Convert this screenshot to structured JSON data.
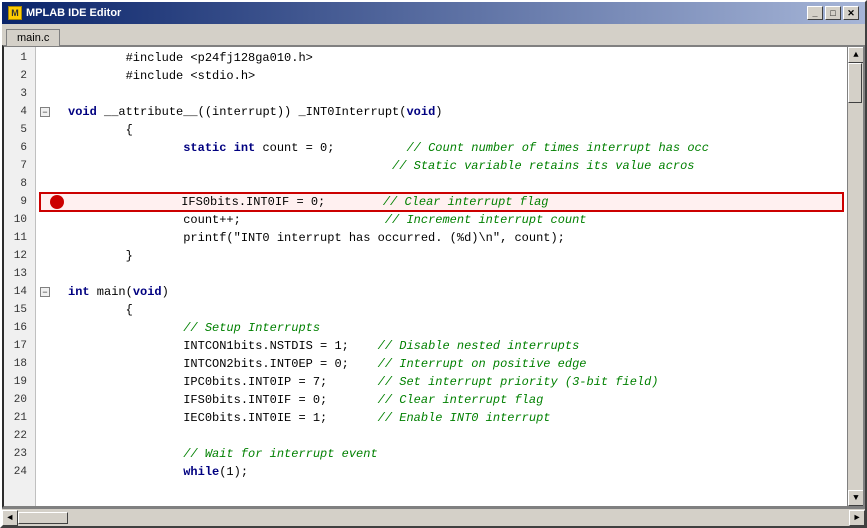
{
  "window": {
    "title": "MPLAB IDE Editor",
    "tab": "main.c"
  },
  "controls": {
    "minimize": "_",
    "maximize": "□",
    "close": "✕"
  },
  "lines": [
    {
      "num": 1,
      "indent": "",
      "fold": false,
      "breakpoint": false,
      "highlight": false,
      "tokens": [
        {
          "t": "normal",
          "v": "        #include <p24fj128ga010.h>"
        }
      ]
    },
    {
      "num": 2,
      "indent": "",
      "fold": false,
      "breakpoint": false,
      "highlight": false,
      "tokens": [
        {
          "t": "normal",
          "v": "        #include <stdio.h>"
        }
      ]
    },
    {
      "num": 3,
      "indent": "",
      "fold": false,
      "breakpoint": false,
      "highlight": false,
      "tokens": [
        {
          "t": "normal",
          "v": ""
        }
      ]
    },
    {
      "num": 4,
      "indent": "",
      "fold": true,
      "breakpoint": false,
      "highlight": false,
      "tokens": [
        {
          "t": "kw-blue",
          "v": "void"
        },
        {
          "t": "normal",
          "v": " __attribute__((interrupt)) _INT0Interrupt("
        },
        {
          "t": "kw-blue",
          "v": "void"
        },
        {
          "t": "normal",
          "v": ")"
        }
      ]
    },
    {
      "num": 5,
      "indent": "",
      "fold": false,
      "breakpoint": false,
      "highlight": false,
      "tokens": [
        {
          "t": "normal",
          "v": "        {"
        }
      ]
    },
    {
      "num": 6,
      "indent": "",
      "fold": false,
      "breakpoint": false,
      "highlight": false,
      "tokens": [
        {
          "t": "normal",
          "v": "                "
        },
        {
          "t": "kw-blue",
          "v": "static"
        },
        {
          "t": "normal",
          "v": " "
        },
        {
          "t": "kw-blue",
          "v": "int"
        },
        {
          "t": "normal",
          "v": " count = 0;          "
        },
        {
          "t": "comment",
          "v": "// Count number of times interrupt has occ"
        }
      ]
    },
    {
      "num": 7,
      "indent": "",
      "fold": false,
      "breakpoint": false,
      "highlight": false,
      "tokens": [
        {
          "t": "comment",
          "v": "                                             // Static variable retains its value acros"
        }
      ]
    },
    {
      "num": 8,
      "indent": "",
      "fold": false,
      "breakpoint": false,
      "highlight": false,
      "tokens": [
        {
          "t": "normal",
          "v": ""
        }
      ]
    },
    {
      "num": 9,
      "indent": "",
      "fold": false,
      "breakpoint": true,
      "highlight": true,
      "tokens": [
        {
          "t": "normal",
          "v": "                IFS0bits.INT0IF = 0;        "
        },
        {
          "t": "comment",
          "v": "// Clear interrupt flag"
        }
      ]
    },
    {
      "num": 10,
      "indent": "",
      "fold": false,
      "breakpoint": false,
      "highlight": false,
      "tokens": [
        {
          "t": "normal",
          "v": "                count++;                    "
        },
        {
          "t": "comment",
          "v": "// Increment interrupt count"
        }
      ]
    },
    {
      "num": 11,
      "indent": "",
      "fold": false,
      "breakpoint": false,
      "highlight": false,
      "tokens": [
        {
          "t": "normal",
          "v": "                printf(\"INT0 interrupt has occurred. (%d)\\n\", count);"
        }
      ]
    },
    {
      "num": 12,
      "indent": "",
      "fold": false,
      "breakpoint": false,
      "highlight": false,
      "tokens": [
        {
          "t": "normal",
          "v": "        }"
        }
      ]
    },
    {
      "num": 13,
      "indent": "",
      "fold": false,
      "breakpoint": false,
      "highlight": false,
      "tokens": [
        {
          "t": "normal",
          "v": ""
        }
      ]
    },
    {
      "num": 14,
      "indent": "",
      "fold": true,
      "breakpoint": false,
      "highlight": false,
      "tokens": [
        {
          "t": "kw-blue",
          "v": "int"
        },
        {
          "t": "normal",
          "v": " main("
        },
        {
          "t": "kw-blue",
          "v": "void"
        },
        {
          "t": "normal",
          "v": ")"
        }
      ]
    },
    {
      "num": 15,
      "indent": "",
      "fold": false,
      "breakpoint": false,
      "highlight": false,
      "tokens": [
        {
          "t": "normal",
          "v": "        {"
        }
      ]
    },
    {
      "num": 16,
      "indent": "",
      "fold": false,
      "breakpoint": false,
      "highlight": false,
      "tokens": [
        {
          "t": "comment",
          "v": "                // Setup Interrupts"
        }
      ]
    },
    {
      "num": 17,
      "indent": "",
      "fold": false,
      "breakpoint": false,
      "highlight": false,
      "tokens": [
        {
          "t": "normal",
          "v": "                INTCON1bits.NSTDIS = 1;    "
        },
        {
          "t": "comment",
          "v": "// Disable nested interrupts"
        }
      ]
    },
    {
      "num": 18,
      "indent": "",
      "fold": false,
      "breakpoint": false,
      "highlight": false,
      "tokens": [
        {
          "t": "normal",
          "v": "                INTCON2bits.INT0EP = 0;    "
        },
        {
          "t": "comment",
          "v": "// Interrupt on positive edge"
        }
      ]
    },
    {
      "num": 19,
      "indent": "",
      "fold": false,
      "breakpoint": false,
      "highlight": false,
      "tokens": [
        {
          "t": "normal",
          "v": "                IPC0bits.INT0IP = 7;       "
        },
        {
          "t": "comment",
          "v": "// Set interrupt priority (3-bit field)"
        }
      ]
    },
    {
      "num": 20,
      "indent": "",
      "fold": false,
      "breakpoint": false,
      "highlight": false,
      "tokens": [
        {
          "t": "normal",
          "v": "                IFS0bits.INT0IF = 0;       "
        },
        {
          "t": "comment",
          "v": "// Clear interrupt flag"
        }
      ]
    },
    {
      "num": 21,
      "indent": "",
      "fold": false,
      "breakpoint": false,
      "highlight": false,
      "tokens": [
        {
          "t": "normal",
          "v": "                IEC0bits.INT0IE = 1;       "
        },
        {
          "t": "comment",
          "v": "// Enable INT0 interrupt"
        }
      ]
    },
    {
      "num": 22,
      "indent": "",
      "fold": false,
      "breakpoint": false,
      "highlight": false,
      "tokens": [
        {
          "t": "normal",
          "v": ""
        }
      ]
    },
    {
      "num": 23,
      "indent": "",
      "fold": false,
      "breakpoint": false,
      "highlight": false,
      "tokens": [
        {
          "t": "comment",
          "v": "                // Wait for interrupt event"
        }
      ]
    },
    {
      "num": 24,
      "indent": "",
      "fold": false,
      "breakpoint": false,
      "highlight": false,
      "tokens": [
        {
          "t": "normal",
          "v": "                "
        },
        {
          "t": "kw-blue",
          "v": "while"
        },
        {
          "t": "normal",
          "v": "(1);"
        }
      ]
    }
  ]
}
